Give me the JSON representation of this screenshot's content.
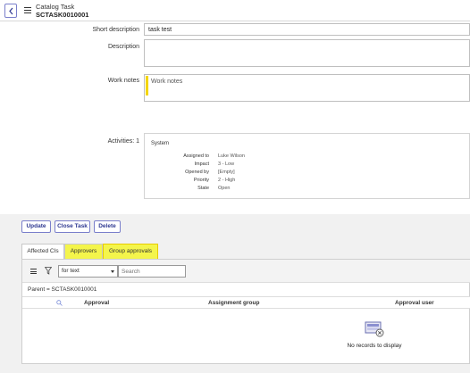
{
  "header": {
    "back_icon": "chevron-left-icon",
    "menu_icon": "hamburger-icon",
    "record_type": "Catalog Task",
    "record_number": "SCTASK0010001"
  },
  "form": {
    "short_description_label": "Short description",
    "short_description_value": "task test",
    "description_label": "Description",
    "description_value": "",
    "work_notes_label": "Work notes",
    "work_notes_placeholder": "Work notes",
    "activities_label": "Activities: 1"
  },
  "activity": {
    "source": "System",
    "rows": [
      {
        "key": "Assigned to",
        "value": "Luke Wilson"
      },
      {
        "key": "Impact",
        "value": "3 - Low"
      },
      {
        "key": "Opened by",
        "value": "[Empty]"
      },
      {
        "key": "Priority",
        "value": "2 - High"
      },
      {
        "key": "State",
        "value": "Open"
      }
    ]
  },
  "actions": {
    "update": "Update",
    "close_task": "Close Task",
    "delete": "Delete"
  },
  "tabs": [
    {
      "label": "Affected CIs"
    },
    {
      "label": "Approvers"
    },
    {
      "label": "Group approvals"
    }
  ],
  "list": {
    "filter_field": "for text",
    "search_placeholder": "Search",
    "breadcrumb": "Parent = SCTASK0010001",
    "columns": [
      "Approval",
      "Assignment group",
      "Approval user"
    ],
    "empty_message": "No records to display"
  },
  "colors": {
    "accent": "#2d3790",
    "highlight": "#f4f54b",
    "work_notes_bar": "#f5d600"
  }
}
